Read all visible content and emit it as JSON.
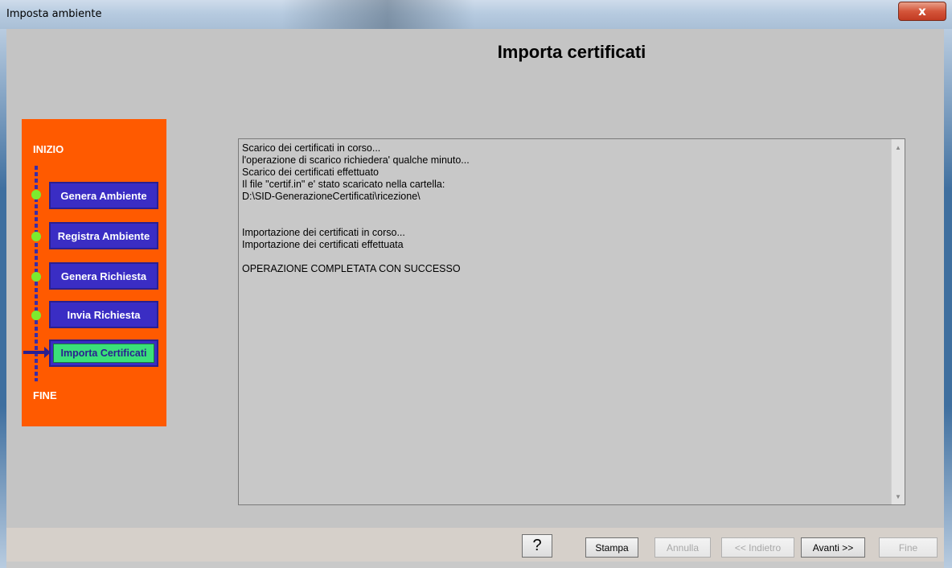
{
  "window": {
    "title": "Imposta ambiente",
    "close_label": "x"
  },
  "page": {
    "heading": "Importa certificati"
  },
  "wizard": {
    "start_label": "INIZIO",
    "end_label": "FINE",
    "steps": [
      {
        "label": "Genera Ambiente",
        "state": "done"
      },
      {
        "label": "Registra Ambiente",
        "state": "done"
      },
      {
        "label": "Genera Richiesta",
        "state": "done"
      },
      {
        "label": "Invia Richiesta",
        "state": "done"
      },
      {
        "label": "Importa Certificati",
        "state": "current"
      }
    ],
    "colors": {
      "panel": "#ff5a00",
      "step_button": "#3a2dc4",
      "done_dot": "#7dea2e",
      "current_fill": "#3ae07a"
    }
  },
  "log": {
    "lines": [
      "Scarico dei certificati in corso...",
      "l'operazione di scarico richiedera' qualche minuto...",
      "Scarico dei certificati effettuato",
      "Il file \"certif.in\" e' stato scaricato nella cartella:",
      "D:\\SID-GenerazioneCertificati\\ricezione\\",
      "",
      "",
      "Importazione dei certificati in corso...",
      "Importazione dei certificati effettuata",
      "",
      "OPERAZIONE COMPLETATA CON SUCCESSO"
    ]
  },
  "buttons": {
    "help": "?",
    "stampa": "Stampa",
    "annulla": "Annulla",
    "indietro": "<< Indietro",
    "avanti": "Avanti >>",
    "fine": "Fine"
  }
}
